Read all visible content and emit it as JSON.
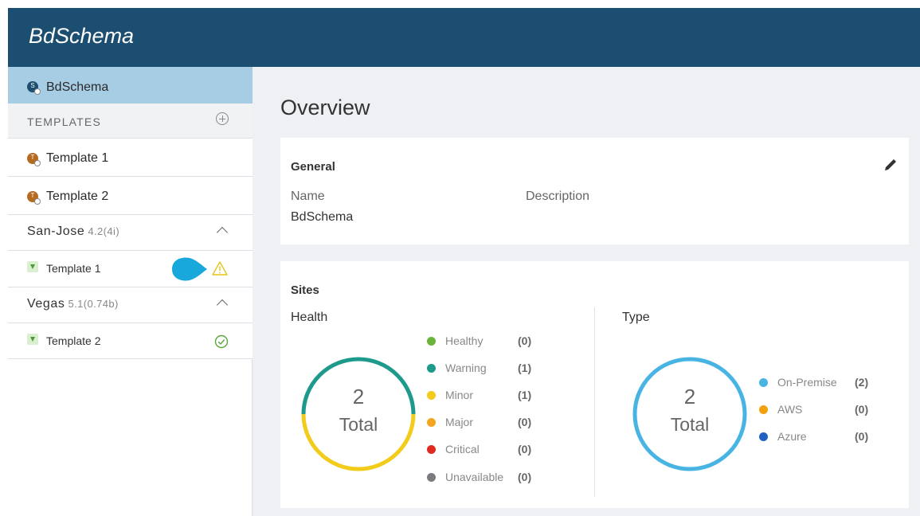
{
  "header": {
    "title": "BdSchema"
  },
  "sidebar": {
    "schema": {
      "label": "BdSchema",
      "badge_letter": "S"
    },
    "templates_header": "TEMPLATES",
    "templates": [
      {
        "label": "Template 1",
        "badge_letter": "T"
      },
      {
        "label": "Template 2",
        "badge_letter": "T"
      }
    ],
    "sites": [
      {
        "name": "San-Jose",
        "version": "4.2(4i)",
        "template": "Template 1",
        "status": "warning-icon"
      },
      {
        "name": "Vegas",
        "version": "5.1(0.74b)",
        "template": "Template 2",
        "status": "check-circle-icon"
      }
    ]
  },
  "main": {
    "title": "Overview",
    "general": {
      "title": "General",
      "name_label": "Name",
      "name_value": "BdSchema",
      "description_label": "Description"
    },
    "sites": {
      "title": "Sites",
      "health": {
        "label": "Health",
        "total": "2",
        "total_label": "Total",
        "items": [
          {
            "label": "Healthy",
            "count": "(0)",
            "color": "#6ab43c"
          },
          {
            "label": "Warning",
            "count": "(1)",
            "color": "#1e9a8c"
          },
          {
            "label": "Minor",
            "count": "(1)",
            "color": "#f2cb1b"
          },
          {
            "label": "Major",
            "count": "(0)",
            "color": "#f3a521"
          },
          {
            "label": "Critical",
            "count": "(0)",
            "color": "#e02a20"
          },
          {
            "label": "Unavailable",
            "count": "(0)",
            "color": "#7a7c80"
          }
        ]
      },
      "type": {
        "label": "Type",
        "total": "2",
        "total_label": "Total",
        "items": [
          {
            "label": "On-Premise",
            "count": "(2)",
            "color": "#47b4e4"
          },
          {
            "label": "AWS",
            "count": "(0)",
            "color": "#f2a10e"
          },
          {
            "label": "Azure",
            "count": "(0)",
            "color": "#2361c1"
          }
        ]
      }
    }
  },
  "colors": {
    "header_bg": "#1b4e70",
    "selected_bg": "#a7cde5",
    "tooltip_pointer": "#19a8dc"
  }
}
